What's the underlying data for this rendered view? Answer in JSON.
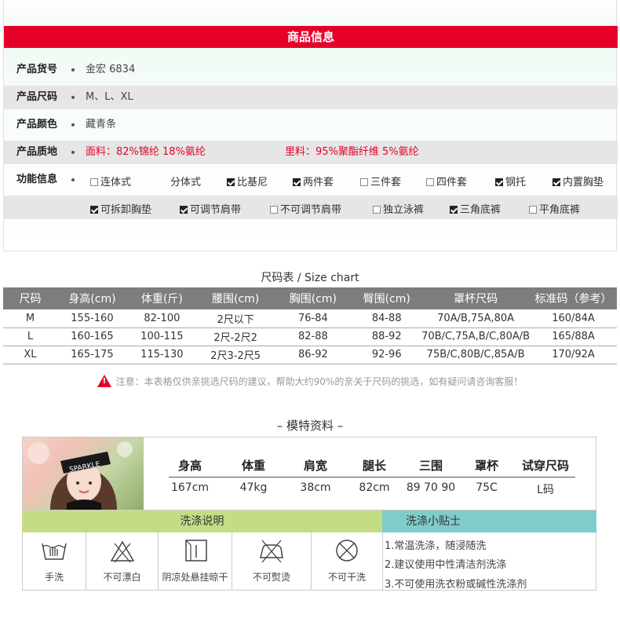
{
  "product_info": {
    "header": "商品信息",
    "rows": [
      {
        "label": "产品货号",
        "value": "金宏 6834"
      },
      {
        "label": "产品尺码",
        "value": "M、L、XL"
      },
      {
        "label": "产品颜色",
        "value": "藏青条"
      },
      {
        "label": "产品质地",
        "value": "面料：82%锦纶 18%氨纶",
        "value2": "里料：95%聚酯纤维 5%氨纶"
      },
      {
        "label": "功能信息"
      }
    ],
    "features": [
      {
        "label": "连体式",
        "checked": false
      },
      {
        "label": "分体式",
        "checked": false,
        "no_box": true
      },
      {
        "label": "比基尼",
        "checked": true
      },
      {
        "label": "两件套",
        "checked": true
      },
      {
        "label": "三件套",
        "checked": false
      },
      {
        "label": "四件套",
        "checked": false
      },
      {
        "label": "钢托",
        "checked": true
      },
      {
        "label": "内置胸垫",
        "checked": true
      },
      {
        "label": "可拆卸胸垫",
        "checked": true
      },
      {
        "label": "可调节肩带",
        "checked": true
      },
      {
        "label": "不可调节肩带",
        "checked": false
      },
      {
        "label": "独立泳裤",
        "checked": false
      },
      {
        "label": "三角底裤",
        "checked": true
      },
      {
        "label": "平角底裤",
        "checked": false
      }
    ]
  },
  "size_chart": {
    "title": "尺码表 / Size chart",
    "headers": [
      "尺码",
      "身高(cm)",
      "体重(斤)",
      "腰围(cm)",
      "胸围(cm)",
      "臀围(cm)",
      "罩杯尺码",
      "标准码（参考）"
    ],
    "rows": [
      [
        "M",
        "155-160",
        "82-100",
        "2尺以下",
        "76-84",
        "84-88",
        "70A/B,75A,80A",
        "160/84A"
      ],
      [
        "L",
        "160-165",
        "100-115",
        "2尺-2尺2",
        "82-88",
        "88-92",
        "70B/C,75A,B/C,80A/B",
        "165/88A"
      ],
      [
        "XL",
        "165-175",
        "115-130",
        "2尺3-2尺5",
        "86-92",
        "92-96",
        "75B/C,80B/C,85A/B",
        "170/92A"
      ]
    ],
    "note": "注意：本表格仅供亲挑选尺码的建议，帮助大约90%的亲关于尺码的挑选，如有疑问请咨询客服！"
  },
  "model": {
    "title": "– 模特资料 –",
    "photo_text": "SPARKLE",
    "headers": [
      "身高",
      "体重",
      "肩宽",
      "腿长",
      "三围",
      "罩杯",
      "试穿尺码"
    ],
    "values": [
      "167cm",
      "47kg",
      "38cm",
      "82cm",
      "89 70 90",
      "75C",
      "L码"
    ]
  },
  "washing": {
    "title": "洗涤说明",
    "tips_title": "洗涤小贴士",
    "icons": [
      {
        "icon": "hand-wash-icon",
        "label": "手洗"
      },
      {
        "icon": "no-bleach-icon",
        "label": "不可漂白"
      },
      {
        "icon": "line-dry-shade-icon",
        "label": "阴凉处悬挂晾干"
      },
      {
        "icon": "no-iron-icon",
        "label": "不可熨烫"
      },
      {
        "icon": "no-dry-clean-icon",
        "label": "不可干洗"
      }
    ],
    "tips": [
      "1.常温洗涤，随浸随洗",
      "2.建议使用中性清洁剂洗涤",
      "3.不可使用洗衣粉或碱性洗涤剂"
    ]
  },
  "colors": {
    "accent_red": "#e5002a",
    "table_header": "#7d7d7d",
    "wash_green": "#c4dd85",
    "wash_teal": "#7fcccb"
  }
}
